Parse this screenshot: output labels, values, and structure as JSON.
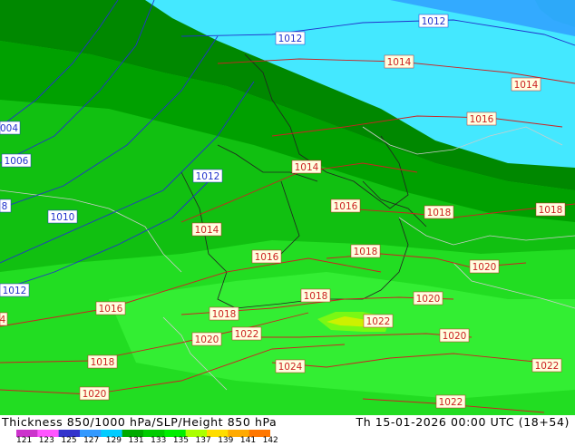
{
  "caption": {
    "left": "Thickness 850/1000 hPa/SLP/Height 850 hPa",
    "right": "Th 15-01-2026 00:00 UTC (18+54)"
  },
  "legend": {
    "ticks": [
      "121",
      "123",
      "125",
      "127",
      "129",
      "131",
      "133",
      "135",
      "137",
      "139",
      "141",
      "142"
    ],
    "colors": [
      "#cc33cc",
      "#ff55ff",
      "#3333cc",
      "#3399ff",
      "#00ccff",
      "#00aa00",
      "#00cc00",
      "#00ee00",
      "#aaff00",
      "#ffdd00",
      "#ffaa00",
      "#ff7700"
    ]
  },
  "isobars": [
    {
      "text": "1012",
      "color": "#2233cc"
    },
    {
      "text": "1012",
      "color": "#2233cc"
    },
    {
      "text": "1014",
      "color": "#cc2222"
    },
    {
      "text": "1014",
      "color": "#cc2222"
    },
    {
      "text": "1016",
      "color": "#cc2222"
    },
    {
      "text": "004",
      "color": "#2233cc"
    },
    {
      "text": "1006",
      "color": "#2233cc"
    },
    {
      "text": "1014",
      "color": "#cc2222"
    },
    {
      "text": "1012",
      "color": "#2233cc"
    },
    {
      "text": "1016",
      "color": "#cc2222"
    },
    {
      "text": "1018",
      "color": "#cc2222"
    },
    {
      "text": "1018",
      "color": "#cc2222"
    },
    {
      "text": "8",
      "color": "#2233cc"
    },
    {
      "text": "1010",
      "color": "#2233cc"
    },
    {
      "text": "1014",
      "color": "#cc2222"
    },
    {
      "text": "1016",
      "color": "#cc2222"
    },
    {
      "text": "1018",
      "color": "#cc2222"
    },
    {
      "text": "1020",
      "color": "#cc2222"
    },
    {
      "text": "1012",
      "color": "#2233cc"
    },
    {
      "text": "1018",
      "color": "#cc2222"
    },
    {
      "text": "1020",
      "color": "#cc2222"
    },
    {
      "text": "4",
      "color": "#cc2222"
    },
    {
      "text": "1016",
      "color": "#cc2222"
    },
    {
      "text": "1018",
      "color": "#cc2222"
    },
    {
      "text": "1022",
      "color": "#cc2222"
    },
    {
      "text": "1020",
      "color": "#cc2222"
    },
    {
      "text": "1022",
      "color": "#cc2222"
    },
    {
      "text": "1020",
      "color": "#cc2222"
    },
    {
      "text": "1018",
      "color": "#cc2222"
    },
    {
      "text": "1024",
      "color": "#cc2222"
    },
    {
      "text": "1022",
      "color": "#cc2222"
    },
    {
      "text": "1020",
      "color": "#cc2222"
    },
    {
      "text": "1022",
      "color": "#cc2222"
    }
  ]
}
